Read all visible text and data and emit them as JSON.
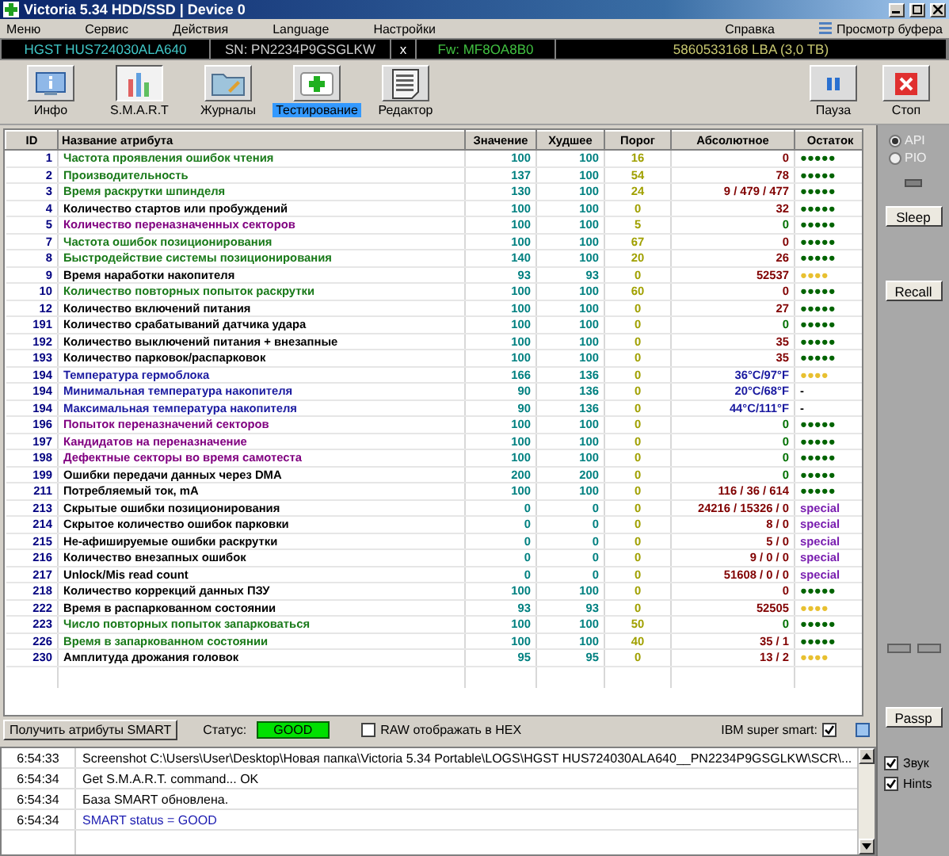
{
  "window": {
    "title": "Victoria 5.34 HDD/SSD | Device 0"
  },
  "menu": {
    "left": [
      "Меню",
      "Сервис",
      "Действия",
      "Language",
      "Настройки"
    ],
    "right": [
      "Справка"
    ],
    "buffer": "Просмотр буфера"
  },
  "device": {
    "model": "HGST HUS724030ALA640",
    "serial": "SN: PN2234P9GSGLKW",
    "close": "x",
    "firmware": "Fw: MF8OA8B0",
    "capacity": "5860533168 LBA (3,0 TB)"
  },
  "tools": [
    {
      "kind": "info",
      "label": "Инфо",
      "selected": false,
      "highlighted": false
    },
    {
      "kind": "smart",
      "label": "S.M.A.R.T",
      "selected": true,
      "highlighted": false
    },
    {
      "kind": "logs",
      "label": "Журналы",
      "selected": false,
      "highlighted": false
    },
    {
      "kind": "test",
      "label": "Тестирование",
      "selected": false,
      "highlighted": true
    },
    {
      "kind": "editor",
      "label": "Редактор",
      "selected": false,
      "highlighted": false
    }
  ],
  "controls": [
    {
      "kind": "pause",
      "label": "Пауза"
    },
    {
      "kind": "stop",
      "label": "Стоп"
    }
  ],
  "table": {
    "columns": [
      "ID",
      "Название атрибута",
      "Значение",
      "Худшее",
      "Порог",
      "Абсолютное",
      "Остаток"
    ],
    "rows": [
      {
        "id": "1",
        "name": "Частота проявления ошибок чтения",
        "color": "#1a7a1a",
        "value": "100",
        "worst": "100",
        "threshold": "16",
        "raw": {
          "text": "0",
          "color": "#800000"
        },
        "health": {
          "text": "●●●●●",
          "color": "#006400"
        }
      },
      {
        "id": "2",
        "name": "Производительность",
        "color": "#1a7a1a",
        "value": "137",
        "worst": "100",
        "threshold": "54",
        "raw": {
          "text": "78",
          "color": "#800000"
        },
        "health": {
          "text": "●●●●●",
          "color": "#006400"
        }
      },
      {
        "id": "3",
        "name": "Время раскрутки шпинделя",
        "color": "#1a7a1a",
        "value": "130",
        "worst": "100",
        "threshold": "24",
        "raw": {
          "text": "9 / 479 / 477",
          "color": "#800000"
        },
        "health": {
          "text": "●●●●●",
          "color": "#006400"
        }
      },
      {
        "id": "4",
        "name": "Количество стартов или пробуждений",
        "color": "#000000",
        "value": "100",
        "worst": "100",
        "threshold": "0",
        "raw": {
          "text": "32",
          "color": "#800000"
        },
        "health": {
          "text": "●●●●●",
          "color": "#006400"
        }
      },
      {
        "id": "5",
        "name": "Количество переназначенных секторов",
        "color": "#800080",
        "value": "100",
        "worst": "100",
        "threshold": "5",
        "raw": {
          "text": "0",
          "color": "#007000"
        },
        "health": {
          "text": "●●●●●",
          "color": "#006400"
        }
      },
      {
        "id": "7",
        "name": "Частота ошибок позиционирования",
        "color": "#1a7a1a",
        "value": "100",
        "worst": "100",
        "threshold": "67",
        "raw": {
          "text": "0",
          "color": "#800000"
        },
        "health": {
          "text": "●●●●●",
          "color": "#006400"
        }
      },
      {
        "id": "8",
        "name": "Быстродействие системы позиционирования",
        "color": "#1a7a1a",
        "value": "140",
        "worst": "100",
        "threshold": "20",
        "raw": {
          "text": "26",
          "color": "#800000"
        },
        "health": {
          "text": "●●●●●",
          "color": "#006400"
        }
      },
      {
        "id": "9",
        "name": "Время наработки накопителя",
        "color": "#000000",
        "value": "93",
        "worst": "93",
        "threshold": "0",
        "raw": {
          "text": "52537",
          "color": "#800000"
        },
        "health": {
          "text": "●●●●",
          "color": "#e8c030"
        }
      },
      {
        "id": "10",
        "name": "Количество повторных попыток раскрутки",
        "color": "#1a7a1a",
        "value": "100",
        "worst": "100",
        "threshold": "60",
        "raw": {
          "text": "0",
          "color": "#800000"
        },
        "health": {
          "text": "●●●●●",
          "color": "#006400"
        }
      },
      {
        "id": "12",
        "name": "Количество включений питания",
        "color": "#000000",
        "value": "100",
        "worst": "100",
        "threshold": "0",
        "raw": {
          "text": "27",
          "color": "#800000"
        },
        "health": {
          "text": "●●●●●",
          "color": "#006400"
        }
      },
      {
        "id": "191",
        "name": "Количество срабатываний датчика удара",
        "color": "#000000",
        "value": "100",
        "worst": "100",
        "threshold": "0",
        "raw": {
          "text": "0",
          "color": "#007000"
        },
        "health": {
          "text": "●●●●●",
          "color": "#006400"
        }
      },
      {
        "id": "192",
        "name": "Количество выключений питания + внезапные",
        "color": "#000000",
        "value": "100",
        "worst": "100",
        "threshold": "0",
        "raw": {
          "text": "35",
          "color": "#800000"
        },
        "health": {
          "text": "●●●●●",
          "color": "#006400"
        }
      },
      {
        "id": "193",
        "name": "Количество парковок/распарковок",
        "color": "#000000",
        "value": "100",
        "worst": "100",
        "threshold": "0",
        "raw": {
          "text": "35",
          "color": "#800000"
        },
        "health": {
          "text": "●●●●●",
          "color": "#006400"
        }
      },
      {
        "id": "194",
        "name": "Температура гермоблока",
        "color": "#1a1aa0",
        "value": "166",
        "worst": "136",
        "threshold": "0",
        "raw": {
          "text": "36°C/97°F",
          "color": "#1a1aa0"
        },
        "health": {
          "text": "●●●●",
          "color": "#e8c030"
        }
      },
      {
        "id": "194",
        "name": "Минимальная температура накопителя",
        "color": "#1a1aa0",
        "value": "90",
        "worst": "136",
        "threshold": "0",
        "raw": {
          "text": "20°C/68°F",
          "color": "#1a1aa0"
        },
        "health": {
          "text": "-",
          "color": "#000000"
        }
      },
      {
        "id": "194",
        "name": "Максимальная температура накопителя",
        "color": "#1a1aa0",
        "value": "90",
        "worst": "136",
        "threshold": "0",
        "raw": {
          "text": "44°C/111°F",
          "color": "#1a1aa0"
        },
        "health": {
          "text": "-",
          "color": "#000000"
        }
      },
      {
        "id": "196",
        "name": "Попыток переназначений секторов",
        "color": "#800080",
        "value": "100",
        "worst": "100",
        "threshold": "0",
        "raw": {
          "text": "0",
          "color": "#007000"
        },
        "health": {
          "text": "●●●●●",
          "color": "#006400"
        }
      },
      {
        "id": "197",
        "name": "Кандидатов на переназначение",
        "color": "#800080",
        "value": "100",
        "worst": "100",
        "threshold": "0",
        "raw": {
          "text": "0",
          "color": "#007000"
        },
        "health": {
          "text": "●●●●●",
          "color": "#006400"
        }
      },
      {
        "id": "198",
        "name": "Дефектные секторы во время самотеста",
        "color": "#800080",
        "value": "100",
        "worst": "100",
        "threshold": "0",
        "raw": {
          "text": "0",
          "color": "#007000"
        },
        "health": {
          "text": "●●●●●",
          "color": "#006400"
        }
      },
      {
        "id": "199",
        "name": "Ошибки передачи данных через DMA",
        "color": "#000000",
        "value": "200",
        "worst": "200",
        "threshold": "0",
        "raw": {
          "text": "0",
          "color": "#007000"
        },
        "health": {
          "text": "●●●●●",
          "color": "#006400"
        }
      },
      {
        "id": "211",
        "name": "Потребляемый ток, mA",
        "color": "#000000",
        "value": "100",
        "worst": "100",
        "threshold": "0",
        "raw": {
          "text": "116 / 36 / 614",
          "color": "#800000"
        },
        "health": {
          "text": "●●●●●",
          "color": "#006400"
        }
      },
      {
        "id": "213",
        "name": "Скрытые ошибки позиционирования",
        "color": "#000000",
        "value": "0",
        "worst": "0",
        "threshold": "0",
        "raw": {
          "text": "24216 / 15326 / 0",
          "color": "#800000"
        },
        "health": {
          "text": "special",
          "color": "#7a1fb0"
        }
      },
      {
        "id": "214",
        "name": "Скрытое количество ошибок парковки",
        "color": "#000000",
        "value": "0",
        "worst": "0",
        "threshold": "0",
        "raw": {
          "text": "8 / 0",
          "color": "#800000"
        },
        "health": {
          "text": "special",
          "color": "#7a1fb0"
        }
      },
      {
        "id": "215",
        "name": "Не-афишируемые ошибки раскрутки",
        "color": "#000000",
        "value": "0",
        "worst": "0",
        "threshold": "0",
        "raw": {
          "text": "5 / 0",
          "color": "#800000"
        },
        "health": {
          "text": "special",
          "color": "#7a1fb0"
        }
      },
      {
        "id": "216",
        "name": "Количество внезапных ошибок",
        "color": "#000000",
        "value": "0",
        "worst": "0",
        "threshold": "0",
        "raw": {
          "text": "9 / 0 / 0",
          "color": "#800000"
        },
        "health": {
          "text": "special",
          "color": "#7a1fb0"
        }
      },
      {
        "id": "217",
        "name": "Unlock/Mis read count",
        "color": "#000000",
        "value": "0",
        "worst": "0",
        "threshold": "0",
        "raw": {
          "text": "51608 / 0 / 0",
          "color": "#800000"
        },
        "health": {
          "text": "special",
          "color": "#7a1fb0"
        }
      },
      {
        "id": "218",
        "name": "Количество коррекций данных ПЗУ",
        "color": "#000000",
        "value": "100",
        "worst": "100",
        "threshold": "0",
        "raw": {
          "text": "0",
          "color": "#800000"
        },
        "health": {
          "text": "●●●●●",
          "color": "#006400"
        }
      },
      {
        "id": "222",
        "name": "Время в распаркованном состоянии",
        "color": "#000000",
        "value": "93",
        "worst": "93",
        "threshold": "0",
        "raw": {
          "text": "52505",
          "color": "#800000"
        },
        "health": {
          "text": "●●●●",
          "color": "#e8c030"
        }
      },
      {
        "id": "223",
        "name": "Число повторных попыток запарковаться",
        "color": "#1a7a1a",
        "value": "100",
        "worst": "100",
        "threshold": "50",
        "raw": {
          "text": "0",
          "color": "#007000"
        },
        "health": {
          "text": "●●●●●",
          "color": "#006400"
        }
      },
      {
        "id": "226",
        "name": "Время в запаркованном состоянии",
        "color": "#1a7a1a",
        "value": "100",
        "worst": "100",
        "threshold": "40",
        "raw": {
          "text": "35 / 1",
          "color": "#800000"
        },
        "health": {
          "text": "●●●●●",
          "color": "#006400"
        }
      },
      {
        "id": "230",
        "name": "Амплитуда дрожания головок",
        "color": "#000000",
        "value": "95",
        "worst": "95",
        "threshold": "0",
        "raw": {
          "text": "13 / 2",
          "color": "#800000"
        },
        "health": {
          "text": "●●●●",
          "color": "#e8c030"
        }
      }
    ]
  },
  "bottom_bar": {
    "button": "Получить атрибуты SMART",
    "status_label": "Статус:",
    "status": "GOOD",
    "raw_hex": {
      "label": "RAW отображать в HEX",
      "checked": false
    },
    "ibm": {
      "label": "IBM super smart:",
      "checked": true
    }
  },
  "log": [
    {
      "time": "6:54:33",
      "message": "Screenshot C:\\Users\\User\\Desktop\\Новая папка\\Victoria 5.34  Portable\\LOGS\\HGST HUS724030ALA640__PN2234P9GSGLKW\\SCR\\...",
      "color": "#000000"
    },
    {
      "time": "6:54:34",
      "message": "Get S.M.A.R.T. command... OK",
      "color": "#000000"
    },
    {
      "time": "6:54:34",
      "message": "База SMART обновлена.",
      "color": "#000000"
    },
    {
      "time": "6:54:34",
      "message": "SMART status = GOOD",
      "color": "#1a1ab0"
    }
  ],
  "side": {
    "modes": [
      {
        "label": "API",
        "selected": true
      },
      {
        "label": "PIO",
        "selected": false
      }
    ],
    "buttons": [
      "Sleep",
      "Recall",
      "Passp"
    ],
    "options": [
      {
        "label": "Звук",
        "checked": true
      },
      {
        "label": "Hints",
        "checked": true
      }
    ]
  }
}
